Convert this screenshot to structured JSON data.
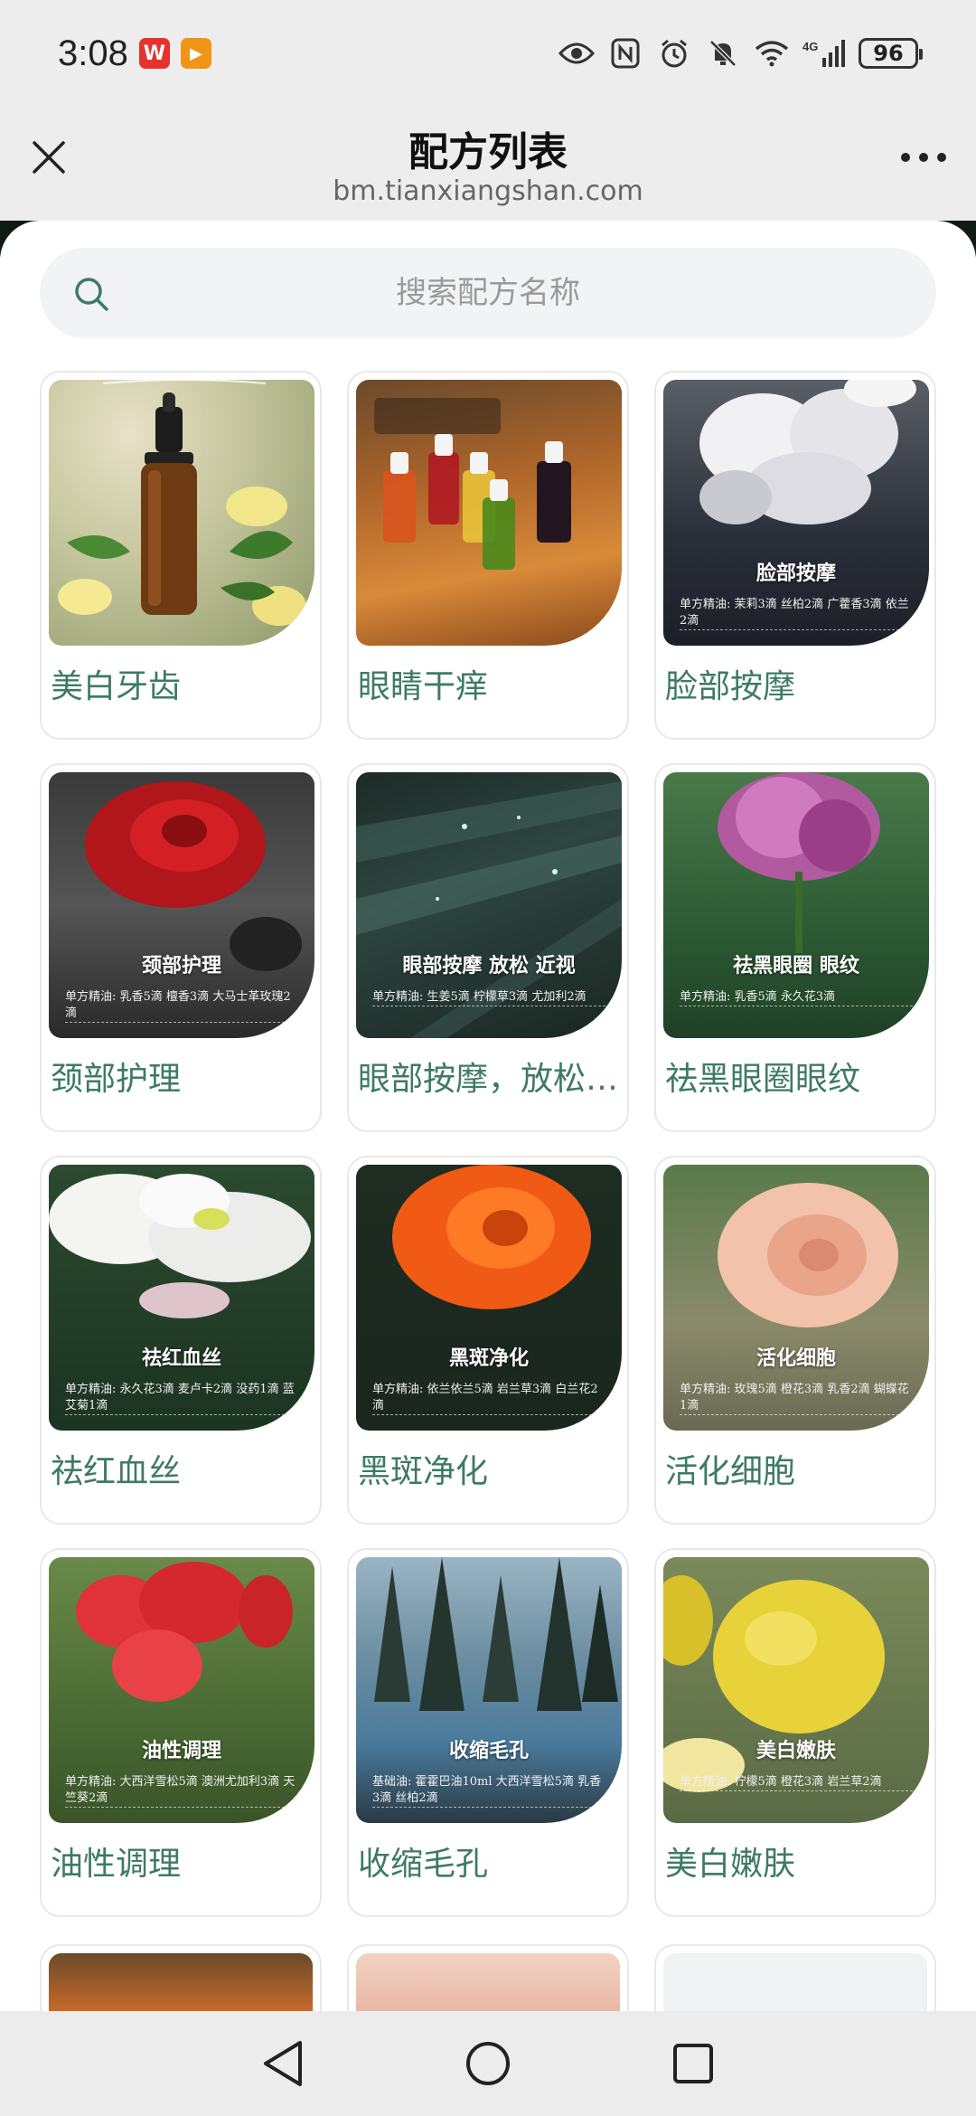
{
  "status_bar": {
    "time": "3:08",
    "badges": [
      {
        "name": "wps-app-icon",
        "glyph": "W",
        "color": "#e5322d"
      },
      {
        "name": "video-app-icon",
        "glyph": "▶",
        "color": "#f29418"
      }
    ],
    "network": "4G",
    "battery": "96"
  },
  "header": {
    "title": "配方列表",
    "url": "bm.tianxiangshan.com"
  },
  "search": {
    "placeholder": "搜索配方名称"
  },
  "cards": [
    {
      "title": "美白牙齿",
      "image": "essential-oil-bottle-lemon",
      "img_label": "",
      "img_sub": ""
    },
    {
      "title": "眼睛干痒",
      "image": "oil-vials-on-table",
      "img_label": "",
      "img_sub": ""
    },
    {
      "title": "脸部按摩",
      "image": "white-peony",
      "img_label": "脸部按摩",
      "img_sub": "单方精油: 茉莉3滴 丝柏2滴 广藿香3滴 依兰2滴"
    },
    {
      "title": "颈部护理",
      "image": "red-rose",
      "img_label": "颈部护理",
      "img_sub": "单方精油: 乳香5滴 檀香3滴 大马士革玫瑰2滴"
    },
    {
      "title": "眼部按摩，放松近视",
      "image": "dewy-leaves",
      "img_label": "眼部按摩 放松 近视",
      "img_sub": "单方精油: 生姜5滴 柠檬草3滴 尤加利2滴"
    },
    {
      "title": "祛黑眼圈眼纹",
      "image": "pink-lotus",
      "img_label": "祛黑眼圈 眼纹",
      "img_sub": "单方精油: 乳香5滴 永久花3滴"
    },
    {
      "title": "祛红血丝",
      "image": "white-lotus",
      "img_label": "祛红血丝",
      "img_sub": "单方精油: 永久花3滴 麦卢卡2滴 没药1滴 蓝艾菊1滴"
    },
    {
      "title": "黑斑净化",
      "image": "orange-rose",
      "img_label": "黑斑净化",
      "img_sub": "单方精油: 依兰依兰5滴 岩兰草3滴 白兰花2滴"
    },
    {
      "title": "活化细胞",
      "image": "peach-rose",
      "img_label": "活化细胞",
      "img_sub": "单方精油: 玫瑰5滴 橙花3滴 乳香2滴 蝴蝶花1滴"
    },
    {
      "title": "油性调理",
      "image": "red-geranium",
      "img_label": "油性调理",
      "img_sub": "单方精油: 大西洋雪松5滴 澳洲尤加利3滴 天竺葵2滴"
    },
    {
      "title": "收缩毛孔",
      "image": "misty-forest",
      "img_label": "收缩毛孔",
      "img_sub": "基础油: 霍霍巴油10ml 大西洋雪松5滴 乳香3滴 丝柏2滴"
    },
    {
      "title": "美白嫩肤",
      "image": "lemon",
      "img_label": "美白嫩肤",
      "img_sub": "单方精油: 柠檬5滴 橙花3滴 岩兰草2滴"
    }
  ],
  "colors": {
    "accent_green": "#3e7a66",
    "background": "#ededed"
  }
}
